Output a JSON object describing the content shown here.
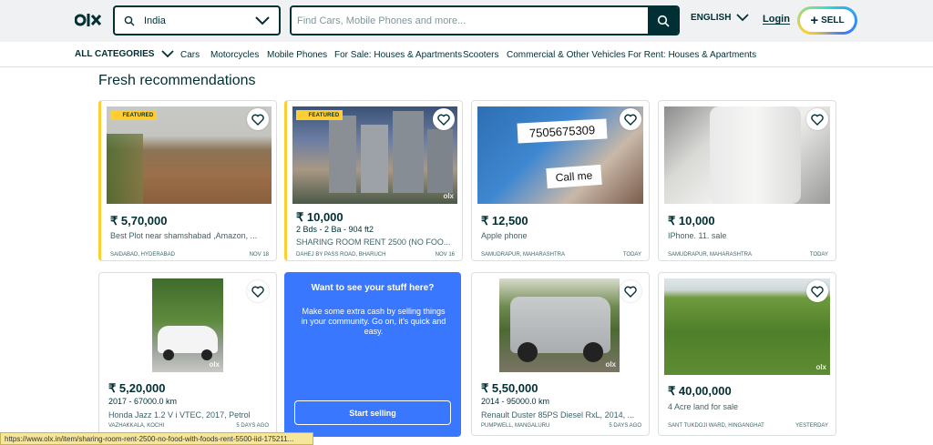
{
  "header": {
    "location_value": "India",
    "search_placeholder": "Find Cars, Mobile Phones and more...",
    "language": "ENGLISH",
    "login": "Login",
    "sell": "SELL"
  },
  "nav": {
    "all_categories": "ALL CATEGORIES",
    "categories": [
      "Cars",
      "Motorcycles",
      "Mobile Phones",
      "For Sale: Houses & Apartments",
      "Scooters",
      "Commercial & Other Vehicles",
      "For Rent: Houses & Apartments"
    ]
  },
  "section_title": "Fresh recommendations",
  "featured_label": "FEATURED",
  "cards": [
    {
      "price": "₹ 5,70,000",
      "sub": "",
      "title": "Best Plot near shamshabad ,Amazon, ...",
      "location": "SAIDABAD, HYDERABAD",
      "date": "NOV 18"
    },
    {
      "price": "₹ 10,000",
      "sub": "2 Bds - 2 Ba - 904 ft2",
      "title": "SHARING ROOM RENT 2500 (NO FOO...",
      "location": "DAHEJ BY PASS ROAD, BHARUCH",
      "date": "NOV 16"
    },
    {
      "price": "₹ 12,500",
      "sub": "",
      "title": "Apple phone",
      "location": "SAMUDRAPUR, MAHARASHTRA",
      "date": "TODAY",
      "photo_text_1": "7505675309",
      "photo_text_2": "Call me"
    },
    {
      "price": "₹ 10,000",
      "sub": "",
      "title": "IPhone. 11. sale",
      "location": "SAMUDRAPUR, MAHARASHTRA",
      "date": "TODAY"
    },
    {
      "price": "₹ 5,20,000",
      "sub": "2017 - 67000.0 km",
      "title": "Honda Jazz 1.2 V i VTEC, 2017, Petrol",
      "location": "VAZHAKKALA, KOCHI",
      "date": "5 DAYS AGO"
    },
    {
      "price": "₹ 5,50,000",
      "sub": "2014 - 95000.0 km",
      "title": "Renault Duster 85PS Diesel RxL, 2014, ...",
      "location": "PUMPWELL, MANGALURU",
      "date": "5 DAYS AGO"
    },
    {
      "price": "₹ 40,00,000",
      "sub": "",
      "title": "4 Acre land for sale",
      "location": "SANT TUKDOJI WARD, HINGANGHAT",
      "date": "YESTERDAY"
    }
  ],
  "promo": {
    "heading": "Want to see your stuff here?",
    "body": "Make some extra cash by selling things in your community. Go on, it's quick and easy.",
    "button": "Start selling"
  },
  "watermark": "olx",
  "status_url": "https://www.olx.in/item/sharing-room-rent-2500-no-food-with-foods-rent-5500-iid-175211..."
}
